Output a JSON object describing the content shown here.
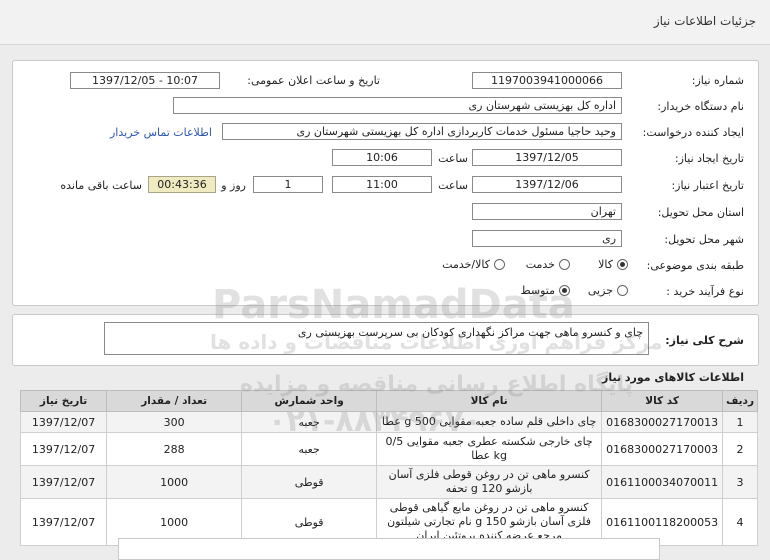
{
  "header": {
    "title": "جزئیات اطلاعات نیاز"
  },
  "form": {
    "need_number_label": "شماره نیاز:",
    "need_number": "1197003941000066",
    "announce_label": "تاریخ و ساعت اعلان عمومی:",
    "announce_value": "1397/12/05 - 10:07",
    "buyer_label": "نام دستگاه خریدار:",
    "buyer_value": "اداره کل بهزیستی شهرستان ری",
    "creator_label": "ایجاد کننده درخواست:",
    "creator_value": "وحید حاجیا مسئول خدمات کاربردازی اداره کل بهزیستی شهرستان ری",
    "contact_link": "اطلاعات تماس خریدار",
    "created_date_label": "تاریخ ایجاد نیاز:",
    "created_date": "1397/12/05",
    "time_label": "ساعت",
    "created_time": "10:06",
    "validity_label": "تاریخ اعتبار نیاز:",
    "validity_date": "1397/12/06",
    "validity_time": "11:00",
    "days_value": "1",
    "days_label": "روز و",
    "remaining_time": "00:43:36",
    "remaining_label": "ساعت باقی مانده",
    "province_label": "استان محل تحویل:",
    "province_value": "تهران",
    "city_label": "شهر محل تحویل:",
    "city_value": "ری",
    "category_label": "طبقه بندی موضوعی:",
    "category_options": [
      "کالا",
      "خدمت",
      "کالا/خدمت"
    ],
    "process_label": "نوع فرآیند خرید :",
    "process_options": [
      "جزیی",
      "متوسط"
    ]
  },
  "description": {
    "label": "شرح کلی نیاز:",
    "text": "چای و کنسرو ماهی جهت مراکز نگهداری کودکان بی سرپرست بهزیستی ری"
  },
  "goods": {
    "section_title": "اطلاعات کالاهای مورد نیاز",
    "columns": [
      "ردیف",
      "کد کالا",
      "نام کالا",
      "واحد شمارش",
      "تعداد / مقدار",
      "تاریخ نیاز"
    ],
    "rows": [
      {
        "row": "1",
        "code": "0168300027170013",
        "name": "چای داخلی قلم ساده جعبه مقوایی 500 g عطا",
        "unit": "جعبه",
        "qty": "300",
        "date": "1397/12/07"
      },
      {
        "row": "2",
        "code": "0168300027170003",
        "name": "چای خارجی شکسته عطری جعبه مقوایی 0/5 kg عطا",
        "unit": "جعبه",
        "qty": "288",
        "date": "1397/12/07"
      },
      {
        "row": "3",
        "code": "0161100034070011",
        "name": "کنسرو ماهی تن در روغن قوطی فلزی آسان بازشو 120 g تحفه",
        "unit": "قوطی",
        "qty": "1000",
        "date": "1397/12/07"
      },
      {
        "row": "4",
        "code": "0161100118200053",
        "name": "کنسرو ماهی تن در روغن مایع گیاهی قوطی فلزی آسان بازشو 150 g نام تجارتی شیلتون مرجع عرضه کننده پروتئین ایران",
        "unit": "قوطی",
        "qty": "1000",
        "date": "1397/12/07"
      }
    ]
  },
  "watermark": {
    "brand": "ParsNamadData",
    "line1": "مرکز فراهم اوری اطلاعات مناقصات و داده ها",
    "line2": "پایگاه اطلاع رسانی مناقصه و مزایده",
    "phone": "۰۲۱-۸۸۳۴۹۶۷۰"
  }
}
